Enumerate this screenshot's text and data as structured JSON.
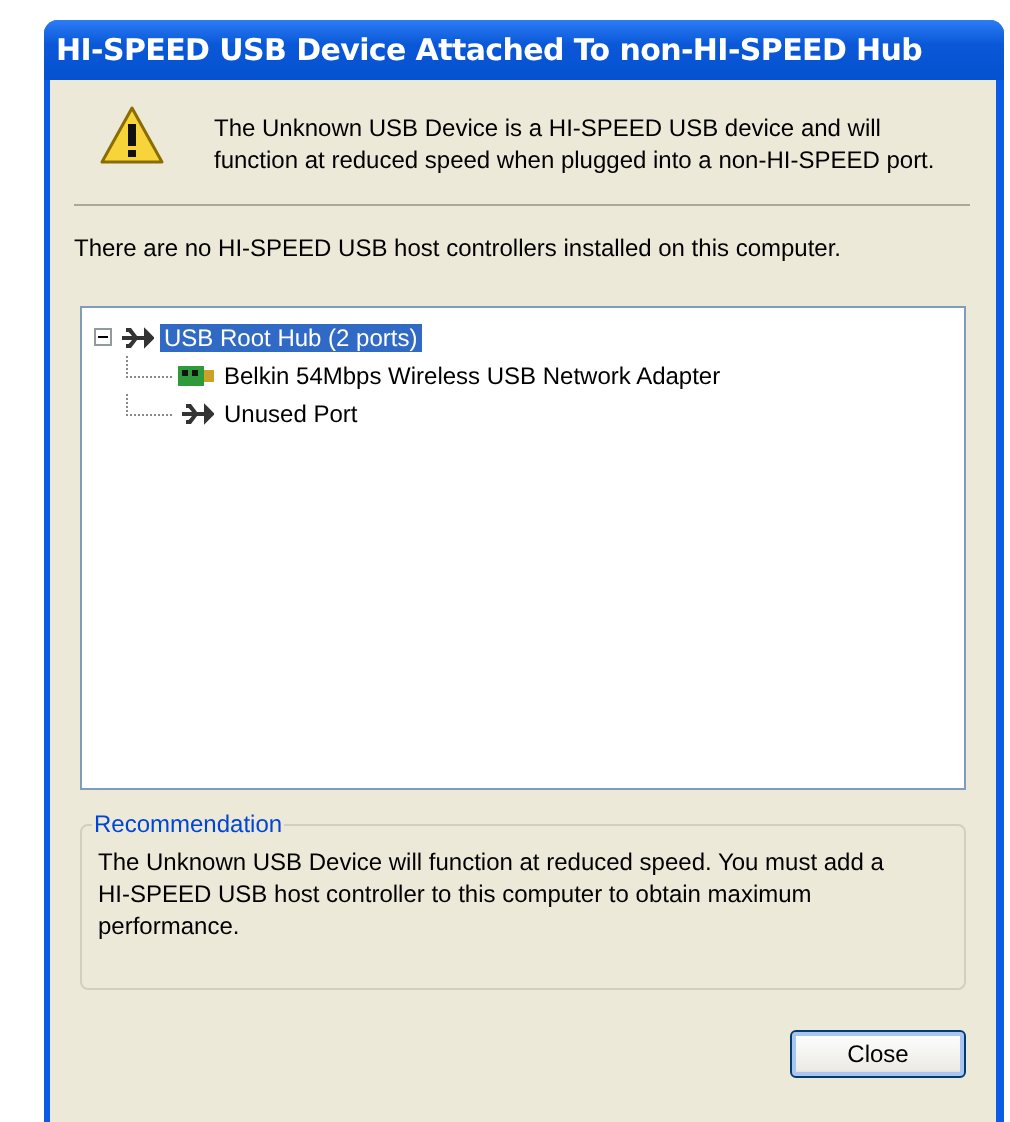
{
  "window": {
    "title": "HI-SPEED USB Device Attached To non-HI-SPEED Hub"
  },
  "message": "The Unknown USB Device is a HI-SPEED USB device and will function at reduced speed when plugged into a non-HI-SPEED port.",
  "info": "There are no HI-SPEED USB host controllers installed on this computer.",
  "tree": [
    {
      "label": "USB Root Hub (2 ports)",
      "kind": "hub",
      "selected": true,
      "expanded": true,
      "children": [
        {
          "label": "Belkin 54Mbps Wireless USB Network Adapter",
          "kind": "adapter",
          "selected": false
        },
        {
          "label": "Unused Port",
          "kind": "hub",
          "selected": false
        }
      ]
    }
  ],
  "recommendation": {
    "title": "Recommendation",
    "text": "The Unknown USB Device will function at reduced speed. You must add a HI-SPEED USB host controller to this computer to obtain maximum performance."
  },
  "buttons": [
    "Close"
  ]
}
